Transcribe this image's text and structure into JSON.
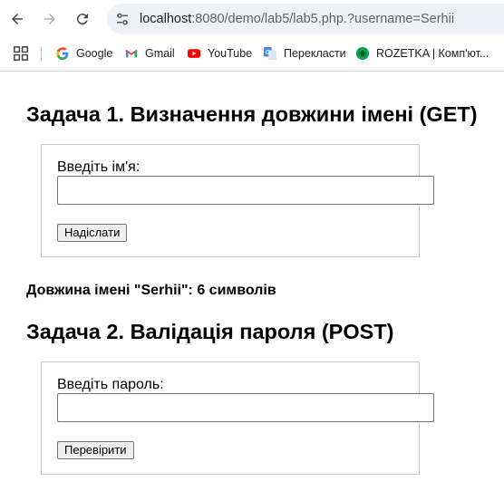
{
  "browser": {
    "url_host": "localhost",
    "url_path": ":8080/demo/lab5/lab5.php.?username=Serhii",
    "bookmarks": [
      {
        "label": "Google",
        "icon": "google-icon"
      },
      {
        "label": "Gmail",
        "icon": "gmail-icon"
      },
      {
        "label": "YouTube",
        "icon": "youtube-icon"
      },
      {
        "label": "Перекласти",
        "icon": "translate-icon"
      },
      {
        "label": "ROZETKA | Комп'ют...",
        "icon": "rozetka-icon"
      }
    ]
  },
  "task1": {
    "title": "Задача 1. Визначення довжини імені (GET)",
    "label": "Введіть ім'я:",
    "input_value": "",
    "button": "Надіслати",
    "result": "Довжина імені \"Serhii\": 6 символів"
  },
  "task2": {
    "title": "Задача 2. Валідація пароля (POST)",
    "label": "Введіть пароль:",
    "input_value": "",
    "button": "Перевірити"
  }
}
